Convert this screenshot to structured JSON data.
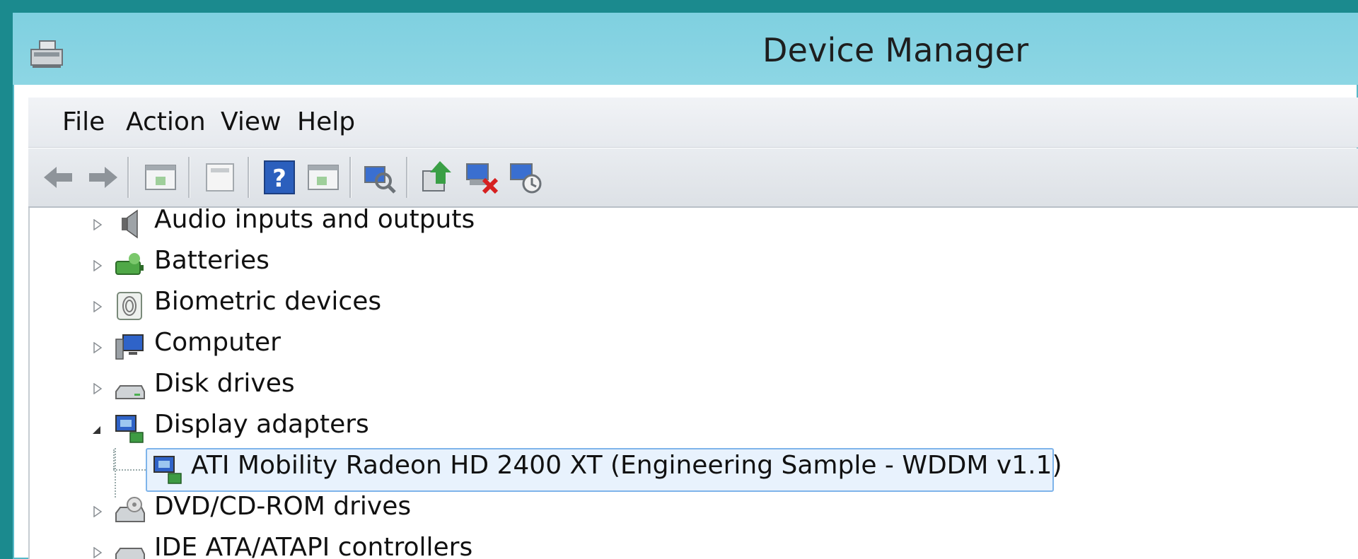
{
  "window": {
    "title": "Device Manager"
  },
  "menu": {
    "items": [
      "File",
      "Action",
      "View",
      "Help"
    ]
  },
  "toolbar": {
    "buttons": [
      "back-icon",
      "forward-icon",
      "show-hide-tree-icon",
      "properties-icon",
      "help-icon",
      "action-pane-icon",
      "scan-hardware-icon",
      "update-driver-icon",
      "uninstall-device-icon",
      "disable-device-icon"
    ]
  },
  "tree": {
    "items": [
      {
        "label": "Audio inputs and outputs",
        "icon": "speaker-icon",
        "expanded": false
      },
      {
        "label": "Batteries",
        "icon": "battery-icon",
        "expanded": false
      },
      {
        "label": "Biometric devices",
        "icon": "fingerprint-icon",
        "expanded": false
      },
      {
        "label": "Computer",
        "icon": "computer-icon",
        "expanded": false
      },
      {
        "label": "Disk drives",
        "icon": "disk-drive-icon",
        "expanded": false
      },
      {
        "label": "Display adapters",
        "icon": "display-adapter-icon",
        "expanded": true
      },
      {
        "label": "ATI Mobility Radeon HD 2400 XT (Engineering Sample - WDDM v1.1)",
        "icon": "display-adapter-icon",
        "child": true,
        "selected": true
      },
      {
        "label": "DVD/CD-ROM drives",
        "icon": "dvd-drive-icon",
        "expanded": false
      },
      {
        "label": "IDE ATA/ATAPI controllers",
        "icon": "ide-controller-icon",
        "expanded": false
      }
    ]
  },
  "colors": {
    "titlebar": "#8dd6e4",
    "selection": "#e8f2fd",
    "selection_border": "#7eb4ea",
    "desktop": "#1b8a8e"
  }
}
